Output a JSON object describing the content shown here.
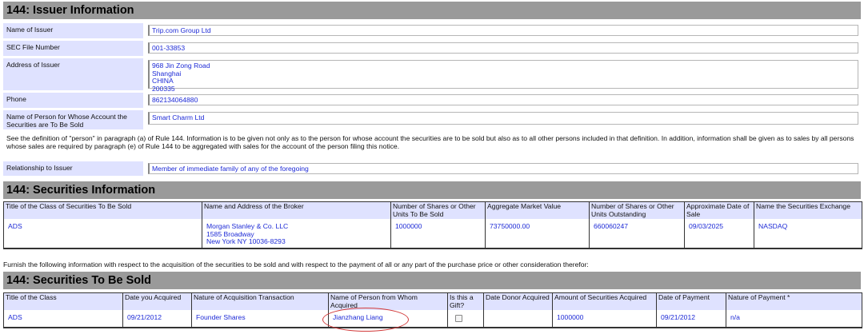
{
  "issuer": {
    "header": "144: Issuer Information",
    "name_label": "Name of Issuer",
    "name_value": "Trip.com Group Ltd",
    "sec_file_label": "SEC File Number",
    "sec_file_value": "001-33853",
    "address_label": "Address of Issuer",
    "address_value": "968 Jin Zong Road\nShanghai\nCHINA\n200335",
    "phone_label": "Phone",
    "phone_value": "862134064880",
    "person_label": "Name of Person for Whose Account the Securities are To Be Sold",
    "person_value": "Smart Charm Ltd",
    "note": "See the definition of \"person\" in paragraph (a) of Rule 144. Information is to be given not only as to the person for whose account the securities are to be sold but also as to all other persons included in that definition. In addition, information shall be given as to sales by all persons whose sales are required by paragraph (e) of Rule 144 to be aggregated with sales for the account of the person filing this notice.",
    "relationship_label": "Relationship to Issuer",
    "relationship_value": "Member of immediate family of any of the foregoing"
  },
  "securities_info": {
    "header": "144: Securities Information",
    "columns": [
      "Title of the Class of Securities To Be Sold",
      "Name and Address of the Broker",
      "Number of Shares or Other Units To Be Sold",
      "Aggregate Market Value",
      "Number of Shares or Other Units Outstanding",
      "Approximate Date of Sale",
      "Name the Securities Exchange"
    ],
    "row": [
      "ADS",
      "Morgan Stanley & Co. LLC\n1585 Broadway\nNew York   NY   10036-8293",
      "1000000",
      "73750000.00",
      "660060247",
      "09/03/2025",
      "NASDAQ"
    ]
  },
  "acquisition_note": "Furnish the following information with respect to the acquisition of the securities to be sold and with respect to the payment of all or any part of the purchase price or other consideration therefor:",
  "securities_sold": {
    "header": "144: Securities To Be Sold",
    "columns": [
      "Title of the Class",
      "Date you Acquired",
      "Nature of Acquisition Transaction",
      "Name of Person from Whom Acquired",
      "Is this a Gift?",
      "Date Donor Acquired",
      "Amount of Securities Acquired",
      "Date of Payment",
      "Nature of Payment *"
    ],
    "row": [
      "ADS",
      "09/21/2012",
      "Founder Shares",
      "Jianzhang Liang",
      "",
      "",
      "1000000",
      "09/21/2012",
      "n/a"
    ]
  },
  "colors": {
    "header_bg": "#9a9a9a",
    "label_bg": "#dfe2ff",
    "value_text": "#1d2ad6",
    "annotation": "#d23a3a"
  }
}
